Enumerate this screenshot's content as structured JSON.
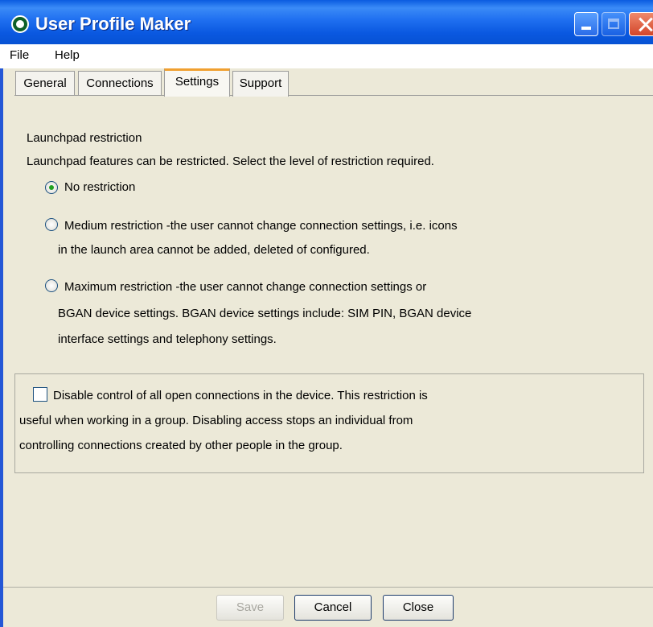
{
  "window": {
    "title": "User Profile Maker"
  },
  "menubar": {
    "file": "File",
    "help": "Help"
  },
  "tabs": {
    "general": "General",
    "connections": "Connections",
    "settings": "Settings",
    "support": "Support"
  },
  "settings": {
    "section_title": "Launchpad restriction",
    "description": "Launchpad features can be restricted.  Select the level of restriction required.",
    "options": {
      "no_restriction": {
        "label": "No restriction",
        "selected": true
      },
      "medium": {
        "line1": "Medium restriction -the user cannot change connection settings, i.e. icons",
        "line2": "in the launch area cannot be added, deleted of configured.",
        "selected": false
      },
      "maximum": {
        "line1": "Maximum restriction -the user cannot change connection settings or",
        "line2": "BGAN device settings. BGAN device settings include: SIM PIN, BGAN device",
        "line3": "interface settings and telephony settings.",
        "selected": false
      }
    },
    "disable_control": {
      "line1": "Disable control of all open connections in the device. This restriction is",
      "line2": "useful when working in a group. Disabling access stops an individual from",
      "line3": "controlling connections created by other people in the group.",
      "checked": false
    }
  },
  "buttons": {
    "save": "Save",
    "cancel": "Cancel",
    "close": "Close"
  },
  "colors": {
    "titlebar": "#0a5be0",
    "active_tab_accent": "#f0a030",
    "radio_dot": "#21a121"
  }
}
